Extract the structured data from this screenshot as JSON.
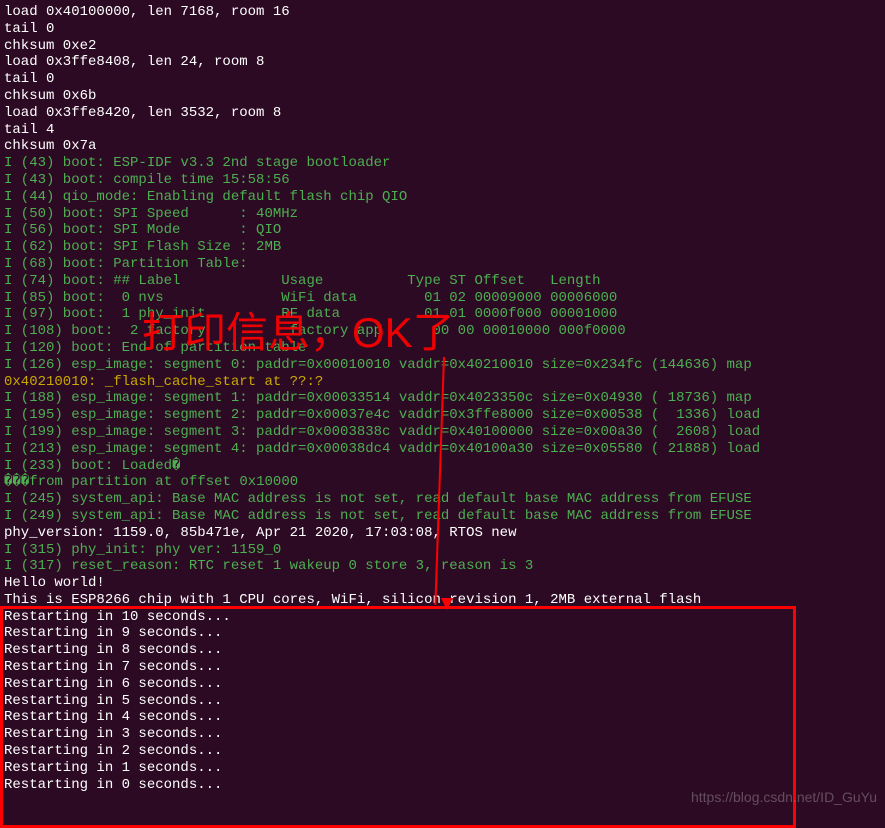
{
  "terminal": {
    "lines": [
      {
        "text": "load 0x40100000, len 7168, room 16",
        "class": "white-text"
      },
      {
        "text": "tail 0",
        "class": "white-text"
      },
      {
        "text": "chksum 0xe2",
        "class": "white-text"
      },
      {
        "text": "load 0x3ffe8408, len 24, room 8",
        "class": "white-text"
      },
      {
        "text": "tail 0",
        "class": "white-text"
      },
      {
        "text": "chksum 0x6b",
        "class": "white-text"
      },
      {
        "text": "load 0x3ffe8420, len 3532, room 8",
        "class": "white-text"
      },
      {
        "text": "tail 4",
        "class": "white-text"
      },
      {
        "text": "chksum 0x7a",
        "class": "white-text"
      },
      {
        "text": "I (43) boot: ESP-IDF v3.3 2nd stage bootloader",
        "class": "green-text"
      },
      {
        "text": "I (43) boot: compile time 15:58:56",
        "class": "green-text"
      },
      {
        "text": "I (44) qio_mode: Enabling default flash chip QIO",
        "class": "green-text"
      },
      {
        "text": "I (50) boot: SPI Speed      : 40MHz",
        "class": "green-text"
      },
      {
        "text": "I (56) boot: SPI Mode       : QIO",
        "class": "green-text"
      },
      {
        "text": "I (62) boot: SPI Flash Size : 2MB",
        "class": "green-text"
      },
      {
        "text": "I (68) boot: Partition Table:",
        "class": "green-text"
      },
      {
        "text": "I (74) boot: ## Label            Usage          Type ST Offset   Length",
        "class": "green-text"
      },
      {
        "text": "I (85) boot:  0 nvs              WiFi data        01 02 00009000 00006000",
        "class": "green-text"
      },
      {
        "text": "I (97) boot:  1 phy_init         RF data          01 01 0000f000 00001000",
        "class": "green-text"
      },
      {
        "text": "I (108) boot:  2 factory          factory app      00 00 00010000 000f0000",
        "class": "green-text"
      },
      {
        "text": "I (120) boot: End of partition table",
        "class": "green-text"
      },
      {
        "text": "I (126) esp_image: segment 0: paddr=0x00010010 vaddr=0x40210010 size=0x234fc (144636) map",
        "class": "green-text"
      },
      {
        "text": "0x40210010: _flash_cache_start at ??:?",
        "class": "yellow-text"
      },
      {
        "text": "",
        "class": "white-text"
      },
      {
        "text": "I (188) esp_image: segment 1: paddr=0x00033514 vaddr=0x4023350c size=0x04930 ( 18736) map",
        "class": "green-text"
      },
      {
        "text": "I (195) esp_image: segment 2: paddr=0x00037e4c vaddr=0x3ffe8000 size=0x00538 (  1336) load",
        "class": "green-text"
      },
      {
        "text": "I (199) esp_image: segment 3: paddr=0x0003838c vaddr=0x40100000 size=0x00a30 (  2608) load",
        "class": "green-text"
      },
      {
        "text": "I (213) esp_image: segment 4: paddr=0x00038dc4 vaddr=0x40100a30 size=0x05580 ( 21888) load",
        "class": "green-text"
      },
      {
        "text": "I (233) boot: Loaded�",
        "class": "green-text"
      },
      {
        "text": "���from partition at offset 0x10000",
        "class": "green-text"
      },
      {
        "text": "I (245) system_api: Base MAC address is not set, read default base MAC address from EFUSE",
        "class": "green-text"
      },
      {
        "text": "I (249) system_api: Base MAC address is not set, read default base MAC address from EFUSE",
        "class": "green-text"
      },
      {
        "text": "phy_version: 1159.0, 85b471e, Apr 21 2020, 17:03:08, RTOS new",
        "class": "white-text"
      },
      {
        "text": "I (315) phy_init: phy ver: 1159_0",
        "class": "green-text"
      },
      {
        "text": "I (317) reset_reason: RTC reset 1 wakeup 0 store 3, reason is 3",
        "class": "green-text"
      },
      {
        "text": "Hello world!",
        "class": "white-text"
      },
      {
        "text": "This is ESP8266 chip with 1 CPU cores, WiFi, silicon revision 1, 2MB external flash",
        "class": "white-text"
      },
      {
        "text": "Restarting in 10 seconds...",
        "class": "white-text"
      },
      {
        "text": "Restarting in 9 seconds...",
        "class": "white-text"
      },
      {
        "text": "Restarting in 8 seconds...",
        "class": "white-text"
      },
      {
        "text": "Restarting in 7 seconds...",
        "class": "white-text"
      },
      {
        "text": "Restarting in 6 seconds...",
        "class": "white-text"
      },
      {
        "text": "Restarting in 5 seconds...",
        "class": "white-text"
      },
      {
        "text": "Restarting in 4 seconds...",
        "class": "white-text"
      },
      {
        "text": "Restarting in 3 seconds...",
        "class": "white-text"
      },
      {
        "text": "Restarting in 2 seconds...",
        "class": "white-text"
      },
      {
        "text": "Restarting in 1 seconds...",
        "class": "white-text"
      },
      {
        "text": "Restarting in 0 seconds...",
        "class": "white-text"
      }
    ]
  },
  "annotation": {
    "text": "打印信息，OK了"
  },
  "watermark": {
    "text": "https://blog.csdn.net/ID_GuYu"
  }
}
